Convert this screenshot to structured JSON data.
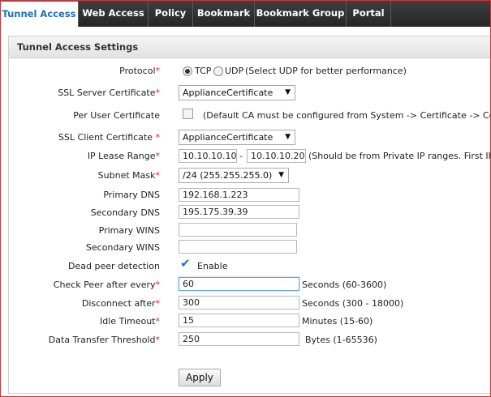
{
  "nav": {
    "tabs": [
      {
        "label": "Tunnel Access",
        "active": true
      },
      {
        "label": "Web Access"
      },
      {
        "label": "Policy"
      },
      {
        "label": "Bookmark"
      },
      {
        "label": "Bookmark Group"
      },
      {
        "label": "Portal"
      }
    ]
  },
  "panel": {
    "title": "Tunnel Access Settings"
  },
  "form": {
    "protocol": {
      "label": "Protocol",
      "required": "*",
      "options": [
        "TCP",
        "UDP"
      ],
      "selected": "TCP",
      "hint": "(Select UDP for better performance)"
    },
    "ssl_server_cert": {
      "label": "SSL Server Certificate",
      "required": "*",
      "value": "ApplianceCertificate"
    },
    "per_user_cert": {
      "label": "Per User Certificate",
      "checked": false,
      "hint": "(Default CA must be configured from System -> Certificate -> Certific"
    },
    "ssl_client_cert": {
      "label": "SSL Client Certificate",
      "required": " *",
      "value": "ApplianceCertificate"
    },
    "ip_lease_range": {
      "label": "IP Lease Range",
      "required": "*",
      "start": "10.10.10.10",
      "separator": "-",
      "end": "10.10.10.20",
      "hint": "(Should be from Private IP ranges. First IP i"
    },
    "subnet_mask": {
      "label": "Subnet Mask",
      "required": "*",
      "value": "/24 (255.255.255.0)"
    },
    "primary_dns": {
      "label": "Primary DNS",
      "value": "192.168.1.223"
    },
    "secondary_dns": {
      "label": "Secondary DNS",
      "value": "195.175.39.39"
    },
    "primary_wins": {
      "label": "Primary WINS",
      "value": ""
    },
    "secondary_wins": {
      "label": "Secondary WINS",
      "value": ""
    },
    "dead_peer": {
      "label": "Dead peer detection",
      "checked": true,
      "option_label": "Enable"
    },
    "check_peer": {
      "label": "Check Peer after every",
      "required": "*",
      "value": "60",
      "unit": "Seconds  (60-3600)"
    },
    "disconnect_after": {
      "label": "Disconnect after",
      "required": "*",
      "value": "300",
      "unit": "Seconds  (300 - 18000)"
    },
    "idle_timeout": {
      "label": "Idle Timeout",
      "required": "*",
      "value": "15",
      "unit": "Minutes  (15-60)"
    },
    "data_transfer": {
      "label": "Data Transfer Threshold",
      "required": "*",
      "value": "250",
      "unit": "Bytes  (1-65536)"
    }
  },
  "actions": {
    "apply": "Apply"
  },
  "icons": {
    "dropdown": "chevron-down-icon",
    "check": "checkmark-icon"
  },
  "colors": {
    "nav_bg": "#2e2e2e",
    "accent": "#1f6fb4",
    "required": "#dd2222",
    "checkmark": "#1e6fd8"
  }
}
